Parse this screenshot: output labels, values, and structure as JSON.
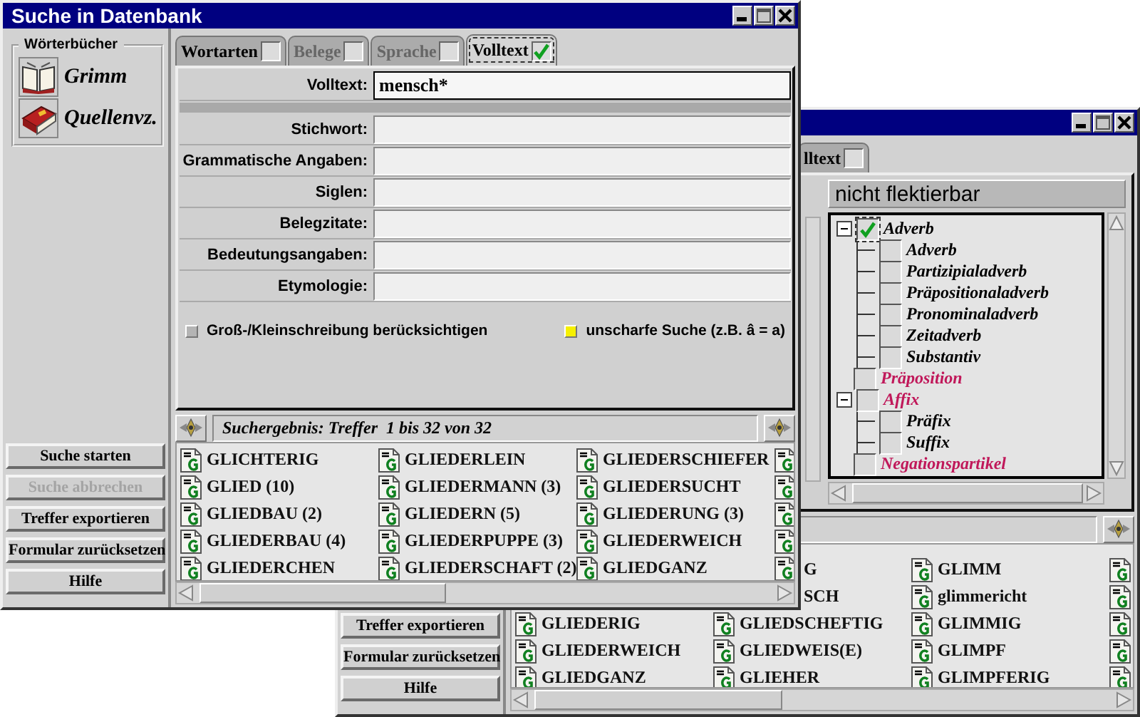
{
  "front_window": {
    "title": "Suche in Datenbank",
    "dictionaries": {
      "label": "Wörterbücher",
      "items": [
        {
          "label": "Grimm",
          "kind": "open_book"
        },
        {
          "label": "Quellenvz.",
          "kind": "closed_book"
        }
      ]
    },
    "buttons": [
      {
        "label": "Suche starten",
        "disabled": false
      },
      {
        "label": "Suche abbrechen",
        "disabled": true
      },
      {
        "label": "Treffer exportieren",
        "disabled": false
      },
      {
        "label": "Formular zurücksetzen",
        "disabled": false
      },
      {
        "label": "Hilfe",
        "disabled": false
      }
    ],
    "tabs": [
      {
        "label": "Wortarten",
        "selected": false,
        "checked": false,
        "disabled": false
      },
      {
        "label": "Belege",
        "selected": false,
        "checked": false,
        "disabled": true
      },
      {
        "label": "Sprache",
        "selected": false,
        "checked": false,
        "disabled": true
      },
      {
        "label": "Volltext",
        "selected": true,
        "checked": true,
        "disabled": false
      }
    ],
    "fulltext": {
      "label": "Volltext:",
      "value": "mensch*"
    },
    "fields": [
      {
        "label": "Stichwort:"
      },
      {
        "label": "Grammatische Angaben:"
      },
      {
        "label": "Siglen:"
      },
      {
        "label": "Belegzitate:"
      },
      {
        "label": "Bedeutungsangaben:"
      },
      {
        "label": "Etymologie:"
      }
    ],
    "options": [
      {
        "label": "Groß-/Kleinschreibung berücksichtigen",
        "checked": false
      },
      {
        "label": "unscharfe Suche (z.B. â = a)",
        "checked": true
      }
    ],
    "result_header": "Suchergebnis: Treffer  1 bis 32 von 32",
    "results": [
      [
        {
          "kind": "entry",
          "text": "GLICHTERIG"
        },
        {
          "kind": "entry",
          "text": "GLIEDERLEIN"
        },
        {
          "kind": "entry",
          "text": "GLIEDERSCHIEFER"
        },
        {
          "kind": "icon"
        }
      ],
      [
        {
          "kind": "entry",
          "text": "GLIED (10)"
        },
        {
          "kind": "entry",
          "text": "GLIEDERMANN (3)"
        },
        {
          "kind": "entry",
          "text": "GLIEDERSUCHT"
        },
        {
          "kind": "icon"
        }
      ],
      [
        {
          "kind": "entry",
          "text": "GLIEDBAU (2)"
        },
        {
          "kind": "entry",
          "text": "GLIEDERN (5)"
        },
        {
          "kind": "entry",
          "text": "GLIEDERUNG (3)"
        },
        {
          "kind": "icon"
        }
      ],
      [
        {
          "kind": "entry",
          "text": "GLIEDERBAU (4)"
        },
        {
          "kind": "entry",
          "text": "GLIEDERPUPPE (3)"
        },
        {
          "kind": "entry",
          "text": "GLIEDERWEICH"
        },
        {
          "kind": "icon"
        }
      ],
      [
        {
          "kind": "entry",
          "text": "GLIEDERCHEN"
        },
        {
          "kind": "entry",
          "text": "GLIEDERSCHAFT (2)"
        },
        {
          "kind": "entry",
          "text": "GLIEDGANZ"
        },
        {
          "kind": "icon"
        }
      ]
    ]
  },
  "back_window": {
    "tabs": [
      {
        "label": "lltext",
        "selected": false,
        "checked": false
      }
    ],
    "category_header": "nicht flektierbar",
    "tree": [
      {
        "label": "Adverb",
        "checked": true,
        "color": "#000000",
        "expanded": true,
        "children": [
          {
            "label": "Adverb",
            "checked": false
          },
          {
            "label": "Partizipialadverb",
            "checked": false
          },
          {
            "label": "Präpositionaladverb",
            "checked": false
          },
          {
            "label": "Pronominaladverb",
            "checked": false
          },
          {
            "label": "Zeitadverb",
            "checked": false
          },
          {
            "label": "Substantiv",
            "checked": false
          }
        ]
      },
      {
        "label": "Präposition",
        "checked": false,
        "color": "#c0185a"
      },
      {
        "label": "Affix",
        "checked": false,
        "color": "#c0185a",
        "expanded": true,
        "children": [
          {
            "label": "Präfix",
            "checked": false
          },
          {
            "label": "Suffix",
            "checked": false
          }
        ]
      },
      {
        "label": "Negationspartikel",
        "checked": false,
        "color": "#c0185a"
      }
    ],
    "buttons": [
      {
        "label": "Treffer exportieren",
        "disabled": false
      },
      {
        "label": "Formular zurücksetzen",
        "disabled": false
      },
      {
        "label": "Hilfe",
        "disabled": false
      }
    ],
    "results": [
      [
        {
          "kind": "covered"
        },
        {
          "kind": "clipped",
          "text": "G"
        },
        {
          "kind": "entry",
          "text": "GLIMM"
        },
        {
          "kind": "icon"
        }
      ],
      [
        {
          "kind": "covered"
        },
        {
          "kind": "clipped",
          "text": "SCH"
        },
        {
          "kind": "entry",
          "text": "glimmericht"
        },
        {
          "kind": "icon"
        }
      ],
      [
        {
          "kind": "entry",
          "text": "GLIEDERIG"
        },
        {
          "kind": "entry",
          "text": "GLIEDSCHEFTIG"
        },
        {
          "kind": "entry",
          "text": "GLIMMIG"
        },
        {
          "kind": "icon"
        }
      ],
      [
        {
          "kind": "entry",
          "text": "GLIEDERWEICH"
        },
        {
          "kind": "entry",
          "text": "GLIEDWEIS(E)"
        },
        {
          "kind": "entry",
          "text": "GLIMPF"
        },
        {
          "kind": "icon"
        }
      ],
      [
        {
          "kind": "entry",
          "text": "GLIEDGANZ"
        },
        {
          "kind": "entry",
          "text": "GLIEHER"
        },
        {
          "kind": "entry",
          "text": "GLIMPFERIG"
        },
        {
          "kind": "icon"
        }
      ]
    ]
  }
}
